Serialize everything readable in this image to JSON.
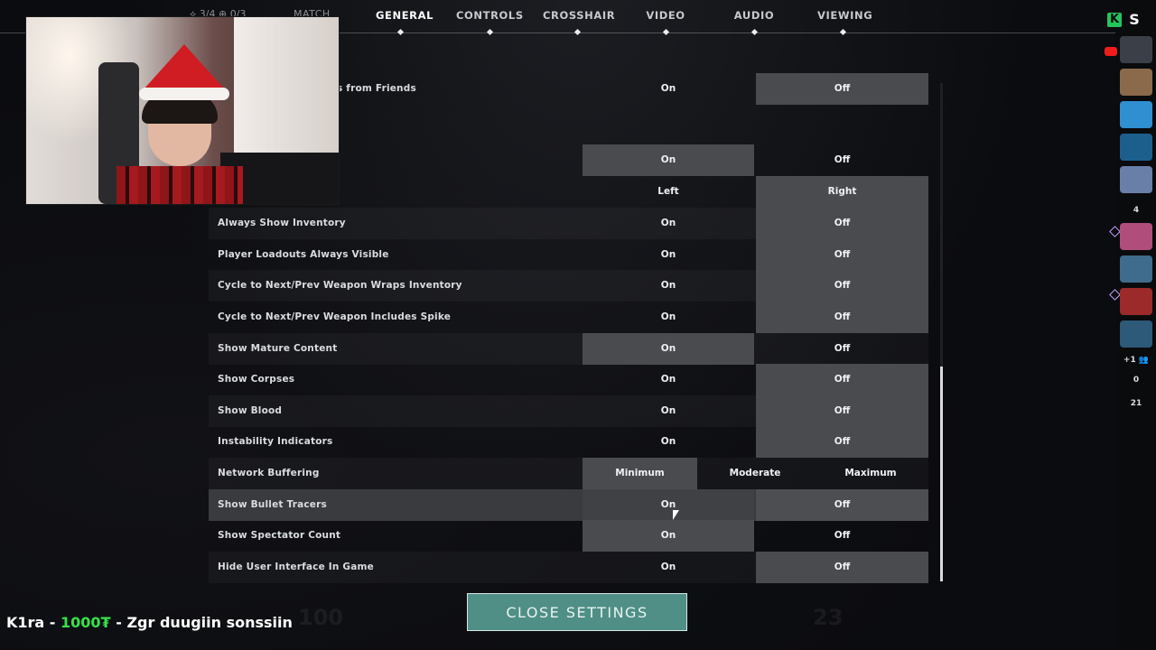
{
  "topbar": {
    "players": "3/4",
    "spectators": "0/3",
    "match_label": "MATCH",
    "tabs": [
      "GENERAL",
      "CONTROLS",
      "CROSSHAIR",
      "VIDEO",
      "AUDIO",
      "VIEWING"
    ],
    "active_tab": "GENERAL"
  },
  "settings": {
    "partial_label": "s from Friends",
    "rows": [
      {
        "label": "",
        "opt1": "On",
        "opt2": "Off",
        "selected": "Off"
      },
      {
        "label": "",
        "opt1": "On",
        "opt2": "Off",
        "selected": "On"
      },
      {
        "label": "",
        "opt1": "Left",
        "opt2": "Right",
        "selected": "Right"
      },
      {
        "label": "Always Show Inventory",
        "opt1": "On",
        "opt2": "Off",
        "selected": "Off"
      },
      {
        "label": "Player Loadouts Always Visible",
        "opt1": "On",
        "opt2": "Off",
        "selected": "Off"
      },
      {
        "label": "Cycle to Next/Prev Weapon Wraps Inventory",
        "opt1": "On",
        "opt2": "Off",
        "selected": "Off"
      },
      {
        "label": "Cycle to Next/Prev Weapon Includes Spike",
        "opt1": "On",
        "opt2": "Off",
        "selected": "Off"
      },
      {
        "label": "Show Mature Content",
        "opt1": "On",
        "opt2": "Off",
        "selected": "On"
      },
      {
        "label": "Show Corpses",
        "opt1": "On",
        "opt2": "Off",
        "selected": "Off"
      },
      {
        "label": "Show Blood",
        "opt1": "On",
        "opt2": "Off",
        "selected": "Off"
      },
      {
        "label": "Instability Indicators",
        "opt1": "On",
        "opt2": "Off",
        "selected": "Off"
      },
      {
        "label": "Network Buffering",
        "options": [
          "Minimum",
          "Moderate",
          "Maximum"
        ],
        "selected": "Minimum"
      },
      {
        "label": "Show Bullet Tracers",
        "opt1": "On",
        "opt2": "Off",
        "selected": "Off"
      },
      {
        "label": "Show Spectator Count",
        "opt1": "On",
        "opt2": "Off",
        "selected": "On"
      },
      {
        "label": "Hide User Interface In Game",
        "opt1": "On",
        "opt2": "Off",
        "selected": "Off"
      }
    ]
  },
  "close_button": "CLOSE SETTINGS",
  "donation": {
    "name": "K1ra",
    "amount": "1000₮",
    "message": "Zgr duugiin sonssiin"
  },
  "sidebar": {
    "count_a": "4",
    "count_b": "+1",
    "count_c": "0",
    "count_d": "21"
  },
  "hud": {
    "left_value": "100",
    "right_value": "23"
  }
}
